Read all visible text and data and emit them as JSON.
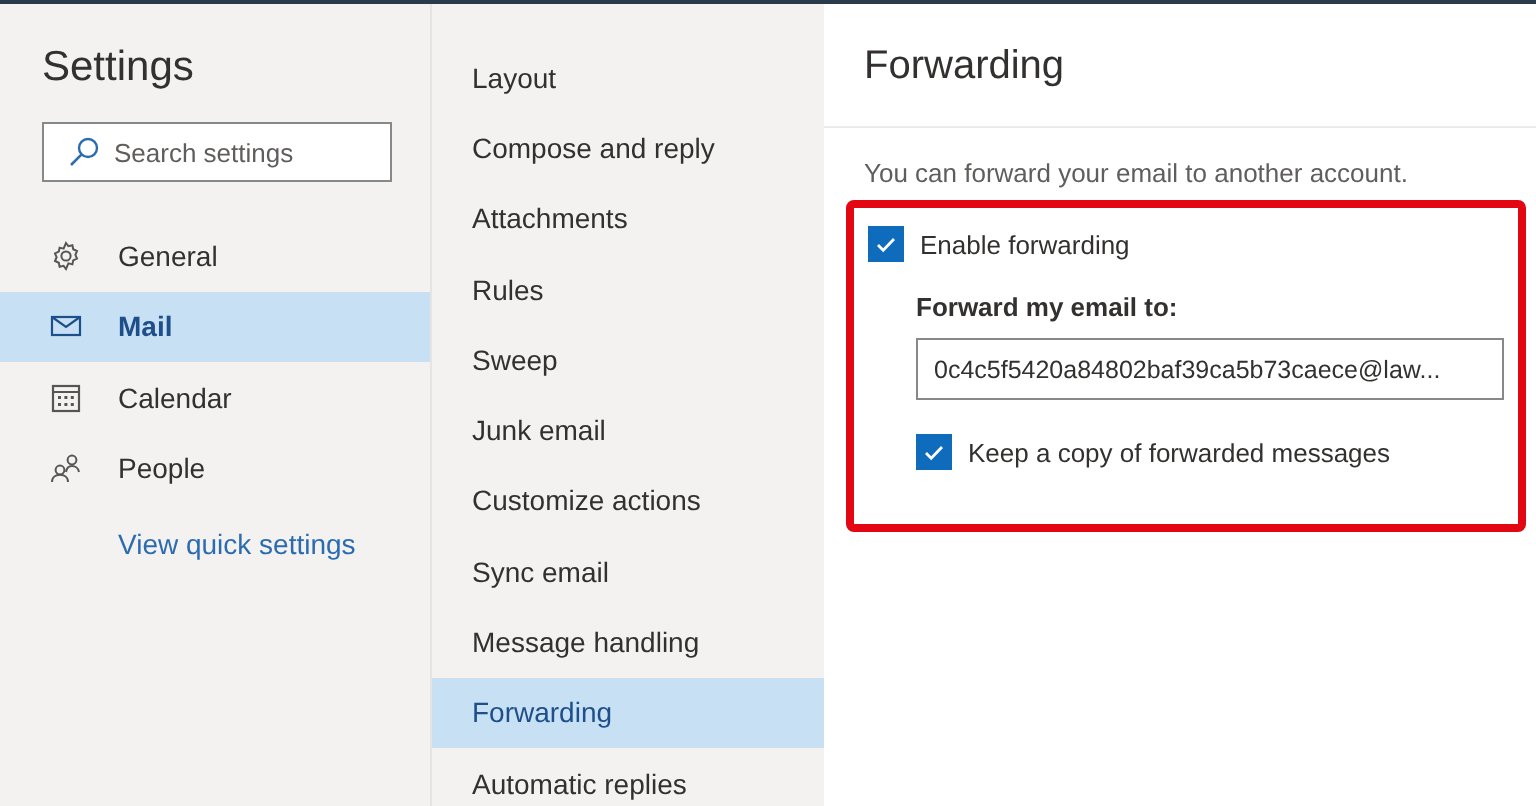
{
  "sidebar": {
    "title": "Settings",
    "search": {
      "placeholder": "Search settings"
    },
    "items": [
      {
        "label": "General",
        "selected": false
      },
      {
        "label": "Mail",
        "selected": true
      },
      {
        "label": "Calendar",
        "selected": false
      },
      {
        "label": "People",
        "selected": false
      }
    ],
    "link": "View quick settings"
  },
  "submenu": {
    "items": [
      {
        "label": "Layout",
        "selected": false
      },
      {
        "label": "Compose and reply",
        "selected": false
      },
      {
        "label": "Attachments",
        "selected": false
      },
      {
        "label": "Rules",
        "selected": false
      },
      {
        "label": "Sweep",
        "selected": false
      },
      {
        "label": "Junk email",
        "selected": false
      },
      {
        "label": "Customize actions",
        "selected": false
      },
      {
        "label": "Sync email",
        "selected": false
      },
      {
        "label": "Message handling",
        "selected": false
      },
      {
        "label": "Forwarding",
        "selected": true
      },
      {
        "label": "Automatic replies",
        "selected": false
      }
    ]
  },
  "panel": {
    "title": "Forwarding",
    "description": "You can forward your email to another account.",
    "enable": {
      "label": "Enable forwarding",
      "checked": true
    },
    "field_label": "Forward my email to:",
    "address": {
      "value": "0c4c5f5420a84802baf39ca5b73caece@law..."
    },
    "keep_copy": {
      "label": "Keep a copy of forwarded messages",
      "checked": true
    }
  }
}
